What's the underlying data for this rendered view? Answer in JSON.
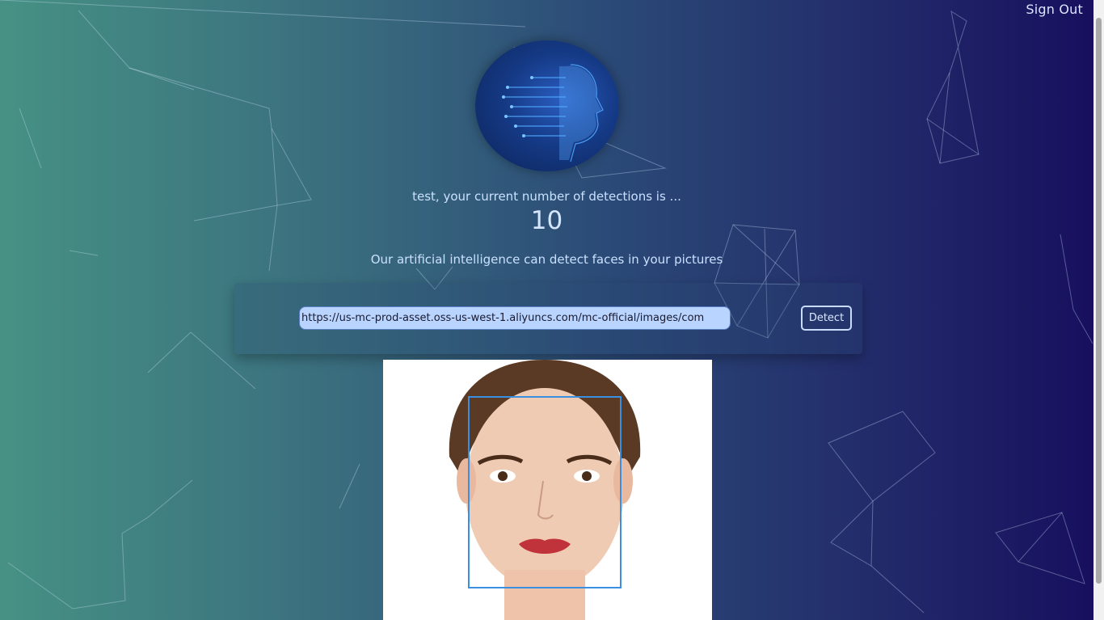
{
  "header": {
    "signout_label": "Sign Out"
  },
  "logo": {
    "icon": "ai-head-logo"
  },
  "detections": {
    "greeting": "test, your current number of detections is ...",
    "count": "10"
  },
  "tagline": "Our artificial intelligence can detect faces in your pictures",
  "form": {
    "url_value": "https://us-mc-prod-asset.oss-us-west-1.aliyuncs.com/mc-official/images/com",
    "detect_label": "Detect"
  },
  "result": {
    "image": "detected-face-photo",
    "box_color": "#3b8fe0"
  },
  "colors": {
    "bg_left": "#469184",
    "bg_right": "#170e5e",
    "text": "#c9e0ff",
    "input_bg": "#b8d4ff"
  }
}
